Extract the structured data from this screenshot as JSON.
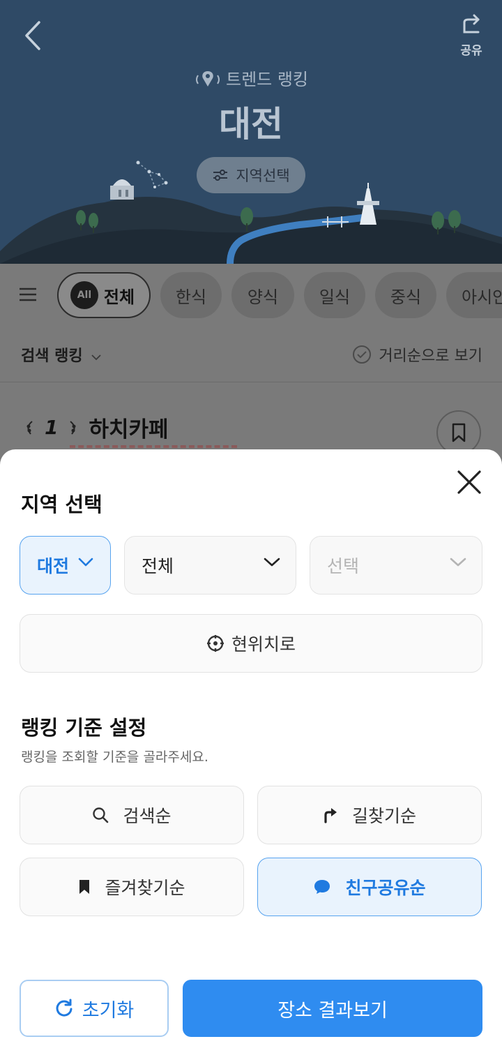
{
  "header": {
    "share_label": "공유",
    "subtitle": "트렌드 랭킹",
    "city": "대전",
    "region_button_label": "지역선택"
  },
  "filter_bar": {
    "chips": [
      {
        "label": "전체",
        "badge": "All",
        "selected": true
      },
      {
        "label": "한식"
      },
      {
        "label": "양식"
      },
      {
        "label": "일식"
      },
      {
        "label": "중식"
      },
      {
        "label": "아시안"
      }
    ]
  },
  "sort_row": {
    "ranking_type": "검색 랭킹",
    "distance_toggle": "거리순으로 보기"
  },
  "list": {
    "items": [
      {
        "rank": "1",
        "name": "하치카페"
      }
    ]
  },
  "sheet": {
    "region_title": "지역 선택",
    "selects": {
      "city": "대전",
      "district": "전체",
      "neighborhood": "선택"
    },
    "current_location_label": "현위치로",
    "criteria_title": "랭킹 기준 설정",
    "criteria_desc": "랭킹을 조회할 기준을 골라주세요.",
    "options": [
      {
        "label": "검색순",
        "icon": "search-icon"
      },
      {
        "label": "길찾기순",
        "icon": "turn-right-icon"
      },
      {
        "label": "즐겨찾기순",
        "icon": "bookmark-icon"
      },
      {
        "label": "친구공유순",
        "icon": "chat-bubble-icon",
        "selected": true
      }
    ],
    "reset_label": "초기화",
    "apply_label": "장소 결과보기"
  },
  "colors": {
    "accent": "#2f8cf0",
    "selected_text": "#1f7ae0",
    "selected_bg": "#e9f3fd",
    "hero_bg": "#2f4a66"
  }
}
